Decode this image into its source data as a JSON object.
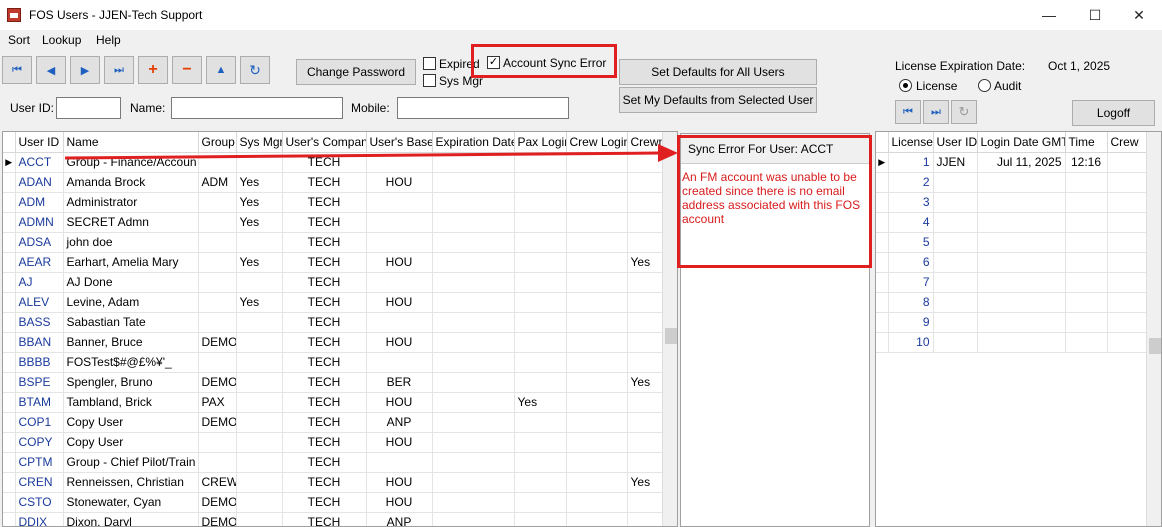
{
  "window": {
    "title": "FOS Users - JJEN-Tech Support",
    "minimize": "—",
    "maximize": "☐",
    "close": "✕"
  },
  "menu": [
    "Sort",
    "Lookup",
    "Help"
  ],
  "toolbar": {
    "first": "⏮",
    "prev": "◀",
    "next": "▶",
    "last": "⏭",
    "add": "+",
    "remove": "−",
    "up": "▲",
    "refresh": "↻",
    "change_password": "Change Password",
    "expired_label": "Expired",
    "sys_mgr_label": "Sys Mgr",
    "account_sync_error_label": "Account Sync Error",
    "account_sync_error_checked": "✓",
    "set_defaults_all": "Set Defaults for All Users",
    "set_my_defaults": "Set My Defaults from Selected User"
  },
  "filters": {
    "user_id_label": "User ID:",
    "name_label": "Name:",
    "mobile_label": "Mobile:",
    "user_id_value": "",
    "name_value": "",
    "mobile_value": ""
  },
  "license_panel": {
    "expiration_label": "License Expiration Date:",
    "expiration_value": "Oct 1, 2025",
    "radio_license": "License",
    "radio_audit": "Audit",
    "first": "⏮",
    "next": "⏭",
    "refresh": "↻",
    "logoff": "Logoff"
  },
  "users_table": {
    "columns": [
      "User ID",
      "Name",
      "Group",
      "Sys Mgr",
      "User's Compan",
      "User's Base",
      "Expiration Date",
      "Pax Login",
      "Crew Login",
      "Crewm"
    ],
    "rows": [
      [
        "ACCT",
        "Group - Finance/Accoun",
        "",
        "",
        "TECH",
        "",
        "",
        "",
        "",
        ""
      ],
      [
        "ADAN",
        "Amanda Brock",
        "ADM",
        "Yes",
        "TECH",
        "HOU",
        "",
        "",
        "",
        ""
      ],
      [
        "ADM",
        "Administrator",
        "",
        "Yes",
        "TECH",
        "",
        "",
        "",
        "",
        ""
      ],
      [
        "ADMN",
        "SECRET Admn",
        "",
        "Yes",
        "TECH",
        "",
        "",
        "",
        "",
        ""
      ],
      [
        "ADSA",
        "john doe",
        "",
        "",
        "TECH",
        "",
        "",
        "",
        "",
        ""
      ],
      [
        "AEAR",
        "Earhart, Amelia Mary",
        "",
        "Yes",
        "TECH",
        "HOU",
        "",
        "",
        "",
        "Yes"
      ],
      [
        "AJ",
        "AJ Done",
        "",
        "",
        "TECH",
        "",
        "",
        "",
        "",
        ""
      ],
      [
        "ALEV",
        "Levine, Adam",
        "",
        "Yes",
        "TECH",
        "HOU",
        "",
        "",
        "",
        ""
      ],
      [
        "BASS",
        "Sabastian Tate",
        "",
        "",
        "TECH",
        "",
        "",
        "",
        "",
        ""
      ],
      [
        "BBAN",
        "Banner, Bruce",
        "DEMO",
        "",
        "TECH",
        "HOU",
        "",
        "",
        "",
        ""
      ],
      [
        "BBBB",
        "FOSTest$#@£%¥'_",
        "",
        "",
        "TECH",
        "",
        "",
        "",
        "",
        ""
      ],
      [
        "BSPE",
        "Spengler, Bruno",
        "DEMO",
        "",
        "TECH",
        "BER",
        "",
        "",
        "",
        "Yes"
      ],
      [
        "BTAM",
        "Tambland, Brick",
        "PAX",
        "",
        "TECH",
        "HOU",
        "",
        "Yes",
        "",
        ""
      ],
      [
        "COP1",
        "Copy User",
        "DEMO",
        "",
        "TECH",
        "ANP",
        "",
        "",
        "",
        ""
      ],
      [
        "COPY",
        "Copy User",
        "",
        "",
        "TECH",
        "HOU",
        "",
        "",
        "",
        ""
      ],
      [
        "CPTM",
        "Group - Chief Pilot/Train",
        "",
        "",
        "TECH",
        "",
        "",
        "",
        "",
        ""
      ],
      [
        "CREN",
        "Renneissen, Christian",
        "CREW",
        "",
        "TECH",
        "HOU",
        "",
        "",
        "",
        "Yes"
      ],
      [
        "CSTO",
        "Stonewater, Cyan",
        "DEMO",
        "",
        "TECH",
        "HOU",
        "",
        "",
        "",
        ""
      ],
      [
        "DDIX",
        "Dixon, Daryl",
        "DEMO",
        "",
        "TECH",
        "ANP",
        "",
        "",
        "",
        ""
      ]
    ]
  },
  "sync_panel": {
    "header": "Sync Error For User:  ACCT",
    "message": "An FM account was unable to be created since there is no email address associated with this FOS account"
  },
  "license_table": {
    "columns": [
      "License",
      "User ID",
      "Login Date GMT",
      "Time",
      "Crew"
    ],
    "rows": [
      [
        "1",
        "JJEN",
        "Jul 11, 2025",
        "12:16",
        ""
      ],
      [
        "2",
        "",
        "",
        "",
        ""
      ],
      [
        "3",
        "",
        "",
        "",
        ""
      ],
      [
        "4",
        "",
        "",
        "",
        ""
      ],
      [
        "5",
        "",
        "",
        "",
        ""
      ],
      [
        "6",
        "",
        "",
        "",
        ""
      ],
      [
        "7",
        "",
        "",
        "",
        ""
      ],
      [
        "8",
        "",
        "",
        "",
        ""
      ],
      [
        "9",
        "",
        "",
        "",
        ""
      ],
      [
        "10",
        "",
        "",
        "",
        ""
      ]
    ]
  },
  "colors": {
    "highlight_red": "#e02020",
    "link_blue": "#1a3a9c"
  }
}
